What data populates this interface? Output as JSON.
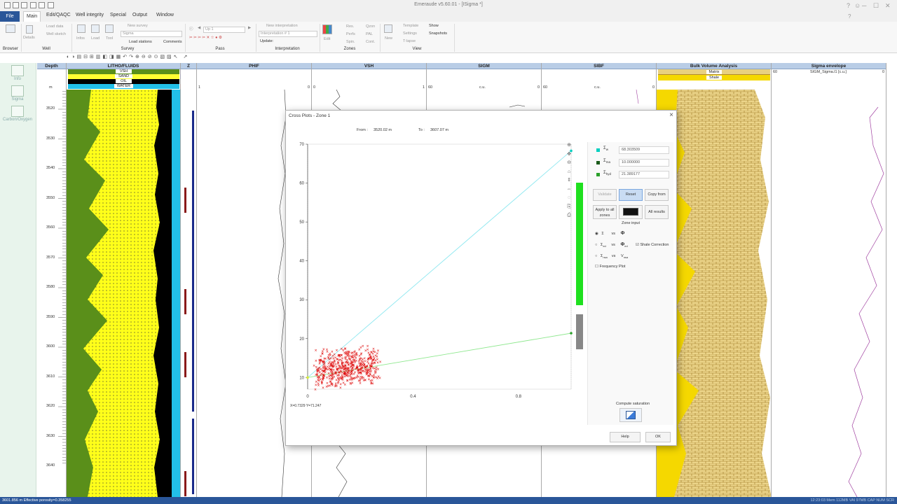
{
  "app": {
    "title": "Emeraude v5.60.01 - [ISigma *]",
    "window_controls": [
      "?",
      "☺",
      "─",
      "☐",
      "✕"
    ]
  },
  "menu": {
    "tabs": [
      "File",
      "Main",
      "Edit/QAQC",
      "Well integrity",
      "Special",
      "Output",
      "Window"
    ]
  },
  "ribbon": {
    "browser": {
      "label": "Browser"
    },
    "well": {
      "label": "Well",
      "details": "Details",
      "load_data": "Load data",
      "well_sketch": "Well sketch"
    },
    "survey": {
      "label": "Survey",
      "infos": "Infos",
      "load": "Load",
      "tool": "Tool",
      "new_survey": "New survey",
      "survey_select": "Sigma",
      "load_stations": "Load stations",
      "comments": "Comments"
    },
    "pass": {
      "label": "Pass",
      "pass_select": "Up 1"
    },
    "interpretation": {
      "label": "Interpretation",
      "new_interpretation": "New interpretation",
      "interp_select": "Interpretation # 1",
      "update": "Update:"
    },
    "zones": {
      "label": "Zones",
      "edit": "Edit",
      "res": "Res.",
      "perfs": "Perfs",
      "spin": "Spin.",
      "qzon": "Qzon",
      "pal": "PAL",
      "cont": "Cont."
    },
    "view": {
      "label": "View",
      "new": "New",
      "template": "Template",
      "settings": "Settings",
      "tlapse": "T-lapse",
      "show": "Show",
      "snapshots": "Snapshots"
    }
  },
  "sidebar": {
    "items": [
      {
        "label": "Info"
      },
      {
        "label": "Sigma"
      },
      {
        "label": "Carbon/Oxygen"
      }
    ]
  },
  "tracks": {
    "depth": {
      "title": "Depth",
      "unit": "m",
      "ticks": [
        "3520",
        "3530",
        "3540",
        "3550",
        "3560",
        "3570",
        "3580",
        "3590",
        "3600",
        "3610",
        "3620",
        "3630",
        "3640"
      ]
    },
    "litho": {
      "title": "LITHO/FLUIDS",
      "legend": [
        "VSH",
        "SAND",
        "OIL",
        "WATER"
      ]
    },
    "z": {
      "title": "Z"
    },
    "phif": {
      "title": "PHIF",
      "left": "1",
      "right": "0"
    },
    "vsh": {
      "title": "VSH",
      "left": "0",
      "right": "1"
    },
    "sigm": {
      "title": "SIGM",
      "left": "60",
      "unit": "c.u.",
      "right": "0"
    },
    "sibf": {
      "title": "SIBF",
      "left": "60",
      "unit": "c.u.",
      "right": "0"
    },
    "bva": {
      "title": "Bulk Volume Analysis",
      "legend": [
        "Matrix",
        "Shale"
      ]
    },
    "sigma_env": {
      "title": "Sigma envelope",
      "left": "60",
      "curve": "SIGM_Sigma.l1 [c.u.]",
      "right": "0"
    }
  },
  "dialog": {
    "title": "Cross Plots - Zone 1",
    "from_label": "From :",
    "from_value": "3520.02 m",
    "to_label": "To :",
    "to_value": "3607.07 m",
    "cursor_readout": "X=0.7329 Y=71.247",
    "sigma_w_value": "68.303509",
    "sigma_ma_value": "10.000000",
    "sigma_hyd_value": "21.389177",
    "buttons": {
      "validate": "Validate",
      "reset": "Reset",
      "copy_from": "Copy from",
      "apply_all": "Apply to all zones",
      "all_results": "All results",
      "zone_input": "Zone input",
      "compute_saturation": "Compute saturation",
      "help": "Help",
      "ok": "OK"
    },
    "options": {
      "shale_correction": "Shale Correction",
      "frequency_plot": "Frequency Plot",
      "vs": "vs"
    },
    "colors": {
      "sigma_w": "#00cfc0",
      "sigma_ma": "#2a8a2a",
      "sigma_hyd": "#2aa02a"
    }
  },
  "chart_data": {
    "type": "scatter",
    "x_ticks": [
      "0",
      "0.4",
      "0.8"
    ],
    "y_ticks": [
      "10",
      "20",
      "30",
      "40",
      "50",
      "60",
      "70"
    ],
    "xlim": [
      0,
      1.0
    ],
    "ylim": [
      7,
      70
    ],
    "matrix_point": [
      0,
      10
    ],
    "water_point": [
      1.0,
      68.3
    ],
    "hydrocarbon_point": [
      1.0,
      21.4
    ],
    "cloud_color": "#dd0000"
  },
  "statusbar": {
    "left": "3601.856 m Effective porosity=0.358255",
    "right": "12:23:03   Mem 112MB   VAI 97MB   CAP  NUM  SCR"
  }
}
